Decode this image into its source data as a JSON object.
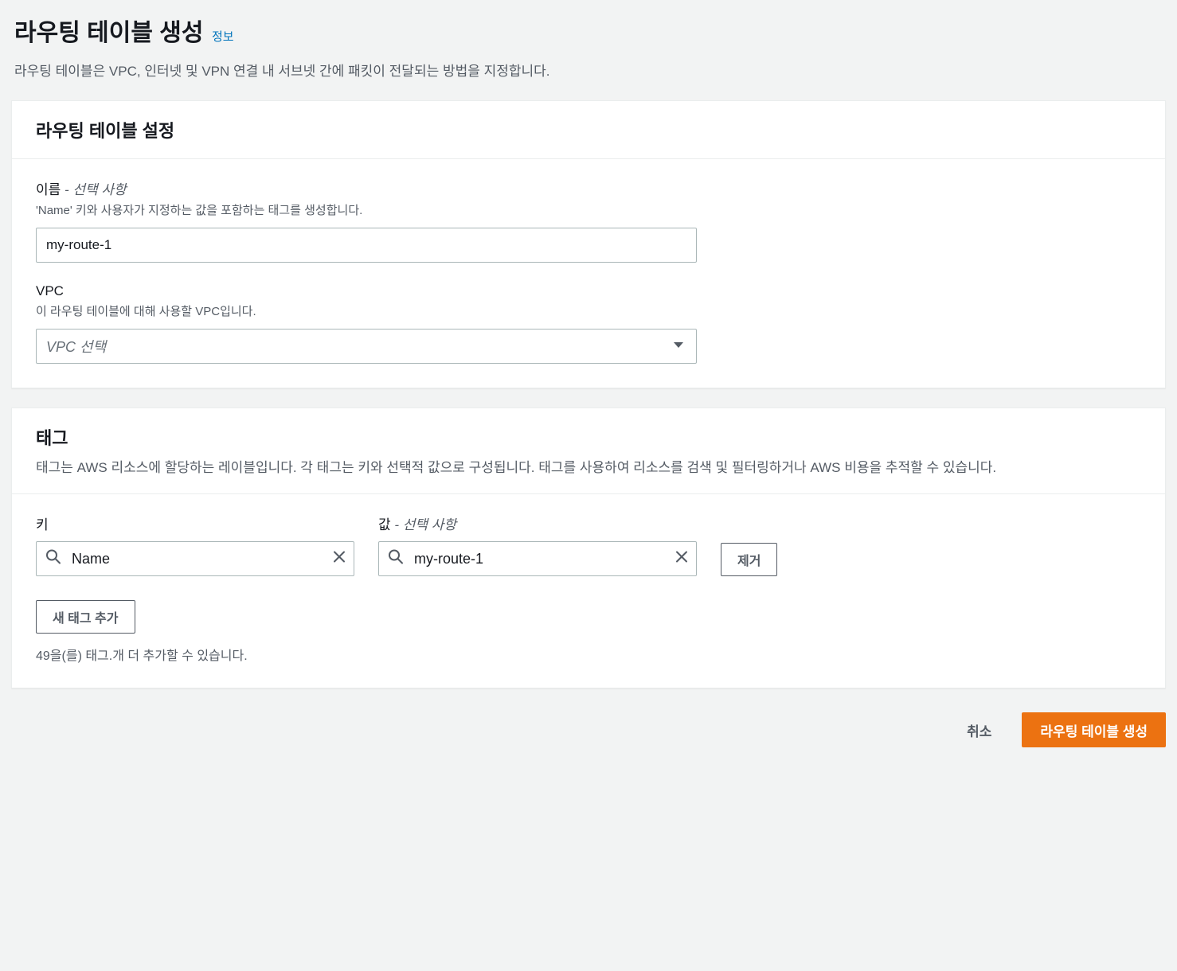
{
  "header": {
    "title": "라우팅 테이블 생성",
    "info_label": "정보",
    "description": "라우팅 테이블은 VPC, 인터넷 및 VPN 연결 내 서브넷 간에 패킷이 전달되는 방법을 지정합니다."
  },
  "settings_panel": {
    "title": "라우팅 테이블 설정",
    "name_field": {
      "label": "이름",
      "optional_suffix": " - 선택 사항",
      "help": "'Name' 키와 사용자가 지정하는 값을 포함하는 태그를 생성합니다.",
      "value": "my-route-1"
    },
    "vpc_field": {
      "label": "VPC",
      "help": "이 라우팅 테이블에 대해 사용할 VPC입니다.",
      "placeholder": "VPC 선택"
    }
  },
  "tags_panel": {
    "title": "태그",
    "description": "태그는 AWS 리소스에 할당하는 레이블입니다. 각 태그는 키와 선택적 값으로 구성됩니다. 태그를 사용하여 리소스를 검색 및 필터링하거나 AWS 비용을 추적할 수 있습니다.",
    "key_label": "키",
    "value_label": "값",
    "value_optional_suffix": " - 선택 사항",
    "rows": [
      {
        "key": "Name",
        "value": "my-route-1"
      }
    ],
    "remove_label": "제거",
    "add_label": "새 태그 추가",
    "limit_text": "49을(를) 태그.개 더 추가할 수 있습니다."
  },
  "footer": {
    "cancel": "취소",
    "submit": "라우팅 테이블 생성"
  }
}
